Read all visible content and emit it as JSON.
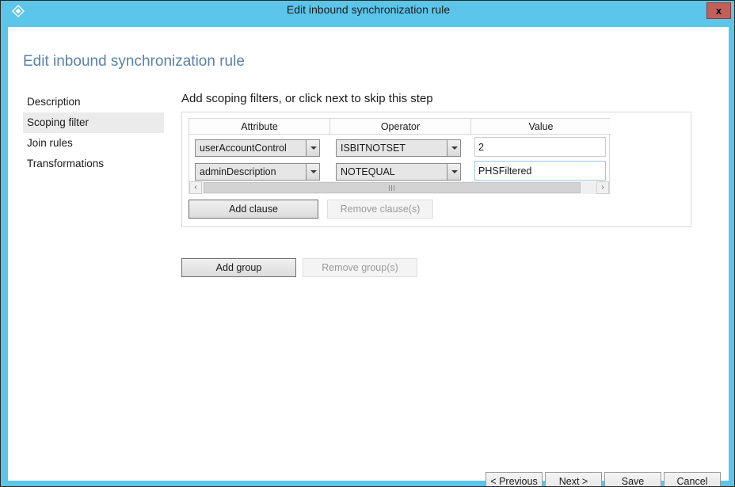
{
  "window": {
    "title": "Edit inbound synchronization rule",
    "icon": "azure-ad-connect-icon",
    "close_label": "x",
    "accent_color": "#5bc5ea",
    "close_color": "#c0605c"
  },
  "page": {
    "heading": "Edit inbound synchronization rule",
    "heading_color": "#5b82a8"
  },
  "sidebar": {
    "items": [
      {
        "label": "Description",
        "selected": false
      },
      {
        "label": "Scoping filter",
        "selected": true
      },
      {
        "label": "Join rules",
        "selected": false
      },
      {
        "label": "Transformations",
        "selected": false
      }
    ],
    "selected_background": "#ebebeb"
  },
  "main": {
    "content_title": "Add scoping filters, or click next to skip this step",
    "table": {
      "columns": [
        "Attribute",
        "Operator",
        "Value"
      ],
      "rows": [
        {
          "attribute": "userAccountControl",
          "operator": "ISBITNOTSET",
          "value": "2",
          "value_focused": false
        },
        {
          "attribute": "adminDescription",
          "operator": "NOTEQUAL",
          "value": "PHSFiltered",
          "value_focused": true
        }
      ]
    },
    "scrollbar": {
      "left_arrow": "‹",
      "right_arrow": "›"
    },
    "clause_buttons": {
      "add": {
        "label": "Add clause",
        "disabled": false
      },
      "remove": {
        "label": "Remove clause(s)",
        "disabled": true
      }
    },
    "group_buttons": {
      "add": {
        "label": "Add group",
        "disabled": false
      },
      "remove": {
        "label": "Remove group(s)",
        "disabled": true
      }
    }
  },
  "footer": {
    "previous": "< Previous",
    "next": "Next >",
    "save": "Save",
    "cancel": "Cancel"
  }
}
